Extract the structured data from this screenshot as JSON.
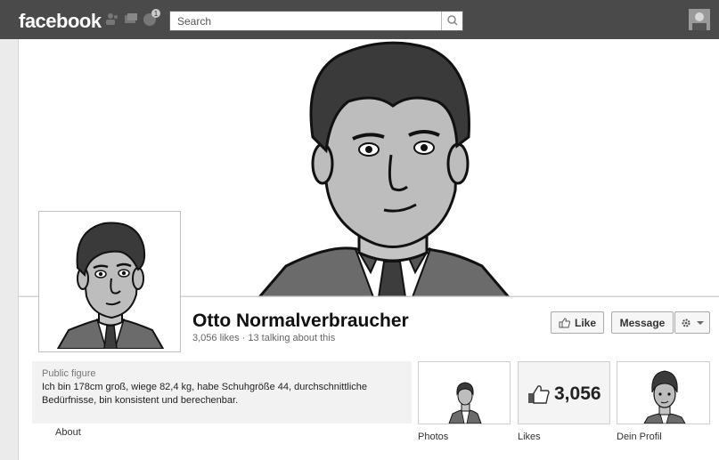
{
  "topbar": {
    "logo": "facebook",
    "search_placeholder": "Search",
    "notification_count": "1"
  },
  "page": {
    "name": "Otto Normalverbraucher",
    "stats": "3,056 likes · 13 talking about this",
    "category": "Public figure",
    "description": "Ich bin 178cm groß, wiege 82,4 kg, habe Schuhgröße 44, durchschnittliche Bedürfnisse, bin konsistent und berechenbar.",
    "about_label": "About"
  },
  "actions": {
    "like_label": "Like",
    "message_label": "Message"
  },
  "tiles": [
    {
      "label": "Photos",
      "icon": "person-photo"
    },
    {
      "label": "Likes",
      "value": "3,056",
      "icon": "thumbs-up-icon"
    },
    {
      "label": "Dein Profil",
      "icon": "profile-face"
    }
  ]
}
